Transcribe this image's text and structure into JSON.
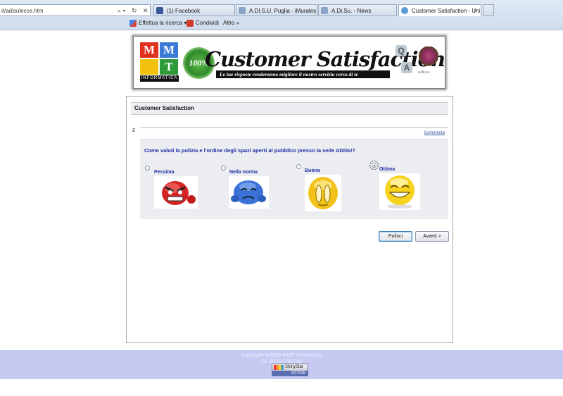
{
  "browser": {
    "address": "it/adisulecce.htm",
    "tabs": [
      {
        "label": "(1) Facebook",
        "favicon_color": "#3b5998"
      },
      {
        "label": "A.DI.S.U. Puglia - iMurales.com",
        "favicon_color": "#8aa5c8"
      },
      {
        "label": "A.Di.Su. - News",
        "favicon_color": "#8aa5c8"
      },
      {
        "label": "Customer Satisfaction - Uni...",
        "favicon_color": "#5a9bd6",
        "active": true
      }
    ],
    "commands": [
      {
        "label": "Effettua la ricerca ▾",
        "icon": "google-icon"
      },
      {
        "label": "Condividi",
        "icon": "share-icon"
      },
      {
        "label": "Altro »",
        "icon": ""
      }
    ]
  },
  "banner": {
    "logo_letters": [
      "M",
      "M",
      "",
      "T"
    ],
    "logo_sub": "INFORMATICA",
    "seal_text": "100%",
    "title": "Customer Satisfaction",
    "subtitle": "Le tue risposte renderanno migliore il nostro servizio verso di te",
    "qa": [
      "Q",
      "A"
    ],
    "tree_label": "a.di.s.u."
  },
  "survey": {
    "header": "Customer Satisfaction",
    "question_number": "2",
    "comment_link": "Commenta",
    "question": "Come valuti la pulizia e l'ordine degli spazi aperti al pubblico presso la sede ADISU?",
    "options": [
      {
        "label": "Pessima",
        "selected": false,
        "emoji": "angry-face-icon",
        "color": "#d62424"
      },
      {
        "label": "Nella norma",
        "selected": false,
        "emoji": "sad-face-icon",
        "color": "#3b72d8"
      },
      {
        "label": "Buona",
        "selected": false,
        "emoji": "neutral-face-icon",
        "color": "#f2c21a"
      },
      {
        "label": "Ottima",
        "selected": true,
        "emoji": "laughing-face-icon",
        "color": "#f6d31e"
      }
    ],
    "buttons": {
      "clear": "Pulisci",
      "next": "Avanti >"
    }
  },
  "footer": {
    "copyright": "Copyright ©2009 MMT Informatica",
    "vat": "P.I. 04197760756",
    "counter_brand": "ShinyStat",
    "counter_value": "007325"
  }
}
